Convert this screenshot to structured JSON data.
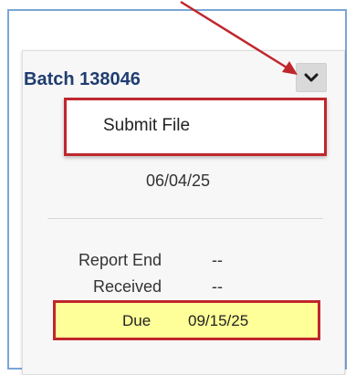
{
  "batch": {
    "title": "Batch 138046",
    "menu_toggle_icon": "chevron-down-icon"
  },
  "menu": {
    "items": [
      {
        "label": "Submit File"
      }
    ]
  },
  "summary": {
    "date": "06/04/25",
    "rows": [
      {
        "label": "Report End",
        "value": "--"
      },
      {
        "label": "Received",
        "value": "--"
      }
    ],
    "due": {
      "label": "Due",
      "value": "09/15/25"
    }
  },
  "annotations": {
    "highlight_color": "#c0272d",
    "due_fill_color": "#ffff99",
    "title_color": "#1f3d70"
  }
}
